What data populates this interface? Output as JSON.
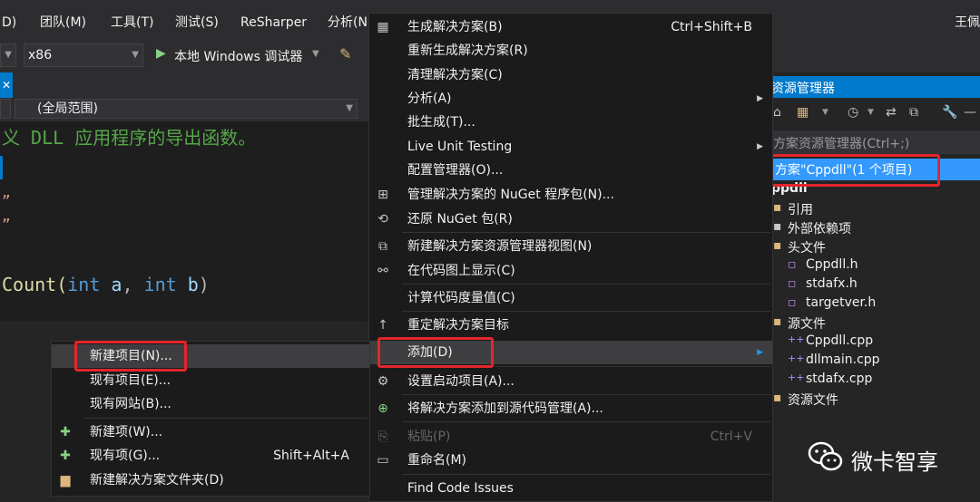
{
  "menubar": {
    "items": [
      "D)",
      "团队(M)",
      "工具(T)",
      "测试(S)",
      "ReSharper",
      "分析(N"
    ],
    "user": "王佩"
  },
  "toolbar": {
    "platform": "x86",
    "run_label": "本地 Windows 调试器"
  },
  "navbar": {
    "scope": "(全局范围)"
  },
  "editor": {
    "lines": [
      "义 DLL 应用程序的导出函数。",
      "”",
      "”"
    ],
    "code_prefix": "Count(",
    "code_kw1": "int",
    "code_p1": " a",
    "code_sep": ", ",
    "code_kw2": "int",
    "code_p2": " b",
    "code_close": ")"
  },
  "context_menu": {
    "items": [
      {
        "label": "生成解决方案(B)",
        "shortcut": "Ctrl+Shift+B",
        "icon": "build-icon"
      },
      {
        "label": "重新生成解决方案(R)"
      },
      {
        "label": "清理解决方案(C)"
      },
      {
        "label": "分析(A)",
        "submenu": true
      },
      {
        "label": "批生成(T)..."
      },
      {
        "label": "Live Unit Testing",
        "submenu": true
      },
      {
        "label": "配置管理器(O)..."
      },
      {
        "label": "管理解决方案的 NuGet 程序包(N)...",
        "icon": "nuget-icon"
      },
      {
        "label": "还原 NuGet 包(R)",
        "icon": "restore-icon"
      },
      {
        "label": "新建解决方案资源管理器视图(N)",
        "icon": "new-view-icon"
      },
      {
        "label": "在代码图上显示(C)",
        "icon": "code-map-icon"
      },
      {
        "label": "计算代码度量值(C)"
      },
      {
        "label": "重定解决方案目标",
        "icon": "arrow-up-icon"
      },
      {
        "label": "添加(D)",
        "submenu": true,
        "highlighted": true
      },
      {
        "label": "设置启动项目(A)...",
        "icon": "gear-icon"
      },
      {
        "label": "将解决方案添加到源代码管理(A)...",
        "icon": "source-control-icon"
      },
      {
        "label": "粘贴(P)",
        "shortcut": "Ctrl+V",
        "disabled": true,
        "icon": "paste-icon"
      },
      {
        "label": "重命名(M)",
        "icon": "rename-icon"
      },
      {
        "label": "Find Code Issues"
      }
    ]
  },
  "submenu": {
    "items": [
      {
        "label": "新建项目(N)...",
        "highlighted": true
      },
      {
        "label": "现有项目(E)..."
      },
      {
        "label": "现有网站(B)..."
      },
      {
        "label": "新建项(W)...",
        "icon": "new-item-icon"
      },
      {
        "label": "现有项(G)...",
        "shortcut": "Shift+Alt+A",
        "icon": "existing-item-icon"
      },
      {
        "label": "新建解决方案文件夹(D)",
        "icon": "folder-icon"
      }
    ]
  },
  "solution_explorer": {
    "title": "资源管理器",
    "search_placeholder": "方案资源管理器(Ctrl+;)",
    "solution_node": "方案\"Cppdll\"(1 个项目)",
    "project": "ppdll",
    "nodes": [
      "引用",
      "外部依赖项",
      "头文件",
      "Cppdll.h",
      "stdafx.h",
      "targetver.h",
      "源文件",
      "Cppdll.cpp",
      "dllmain.cpp",
      "stdafx.cpp",
      "资源文件"
    ]
  },
  "watermark": "微卡智享",
  "colors": {
    "accent": "#007acc",
    "highlight_box": "#e3262b",
    "comment": "#57a64a",
    "keyword": "#569cd6"
  }
}
